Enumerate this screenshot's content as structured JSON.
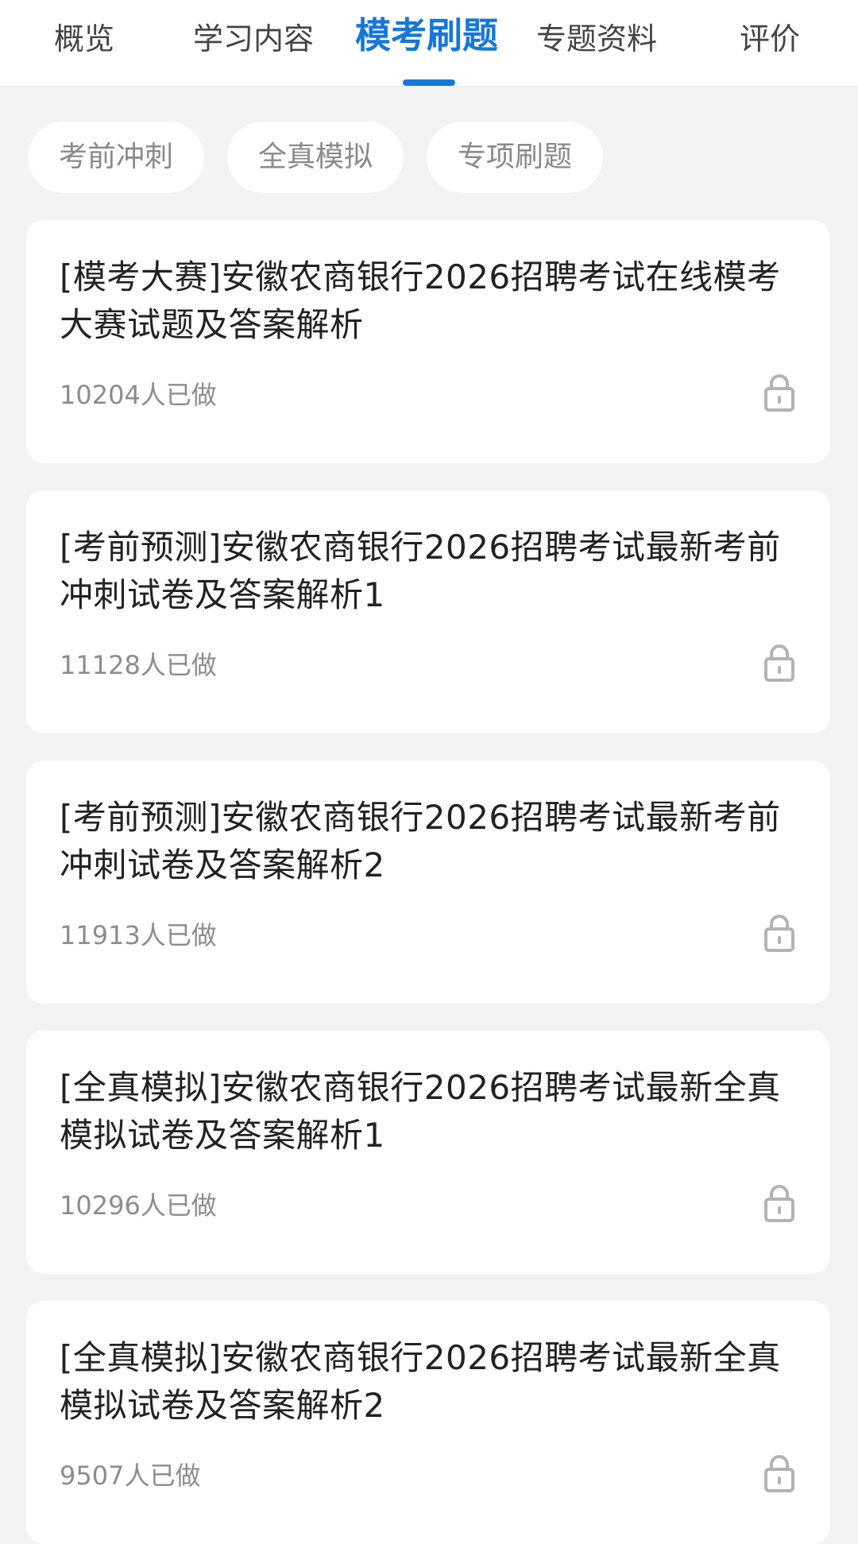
{
  "tabs": [
    {
      "label": "概览"
    },
    {
      "label": "学习内容"
    },
    {
      "label": "模考刷题"
    },
    {
      "label": "专题资料"
    },
    {
      "label": "评价"
    }
  ],
  "active_tab": "模考刷题",
  "filters": [
    {
      "label": "考前冲刺"
    },
    {
      "label": "全真模拟"
    },
    {
      "label": "专项刷题"
    }
  ],
  "items": [
    {
      "title": "[模考大赛]安徽农商银行2026招聘考试在线模考大赛试题及答案解析",
      "count": "10204人已做",
      "icon": "lock-icon"
    },
    {
      "title": "[考前预测]安徽农商银行2026招聘考试最新考前冲刺试卷及答案解析1",
      "count": "11128人已做",
      "icon": "lock-icon"
    },
    {
      "title": "[考前预测]安徽农商银行2026招聘考试最新考前冲刺试卷及答案解析2",
      "count": "11913人已做",
      "icon": "lock-icon"
    },
    {
      "title": "[全真模拟]安徽农商银行2026招聘考试最新全真模拟试卷及答案解析1",
      "count": "10296人已做",
      "icon": "lock-icon"
    },
    {
      "title": "[全真模拟]安徽农商银行2026招聘考试最新全真模拟试卷及答案解析2",
      "count": "9507人已做",
      "icon": "lock-icon"
    }
  ],
  "colors": {
    "accent": "#1677d8",
    "background": "#f3f3f3",
    "card": "#ffffff",
    "muted_text": "#8c8c8c"
  }
}
